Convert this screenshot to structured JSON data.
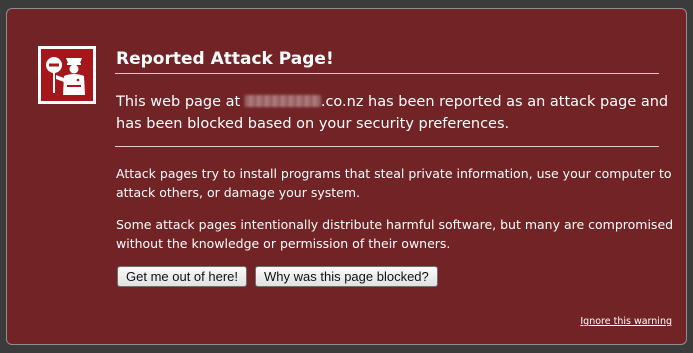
{
  "colors": {
    "background": "#722325",
    "text": "#ffffff",
    "icon_fill": "#a5171b"
  },
  "icon": "policeman-stop-sign-icon",
  "title": "Reported Attack Page!",
  "short_desc": {
    "before": "This web page at ",
    "host_suffix": ".co.nz",
    "after": " has been reported as an attack page and has been blocked based on your security preferences."
  },
  "long_desc": [
    "Attack pages try to install programs that steal private information, use your computer to attack others, or damage your system.",
    "Some attack pages intentionally distribute harmful software, but many are compromised without the knowledge or permission of their owners."
  ],
  "buttons": {
    "get_me_out": "Get me out of here!",
    "why_blocked": "Why was this page blocked?"
  },
  "ignore_link": "Ignore this warning"
}
